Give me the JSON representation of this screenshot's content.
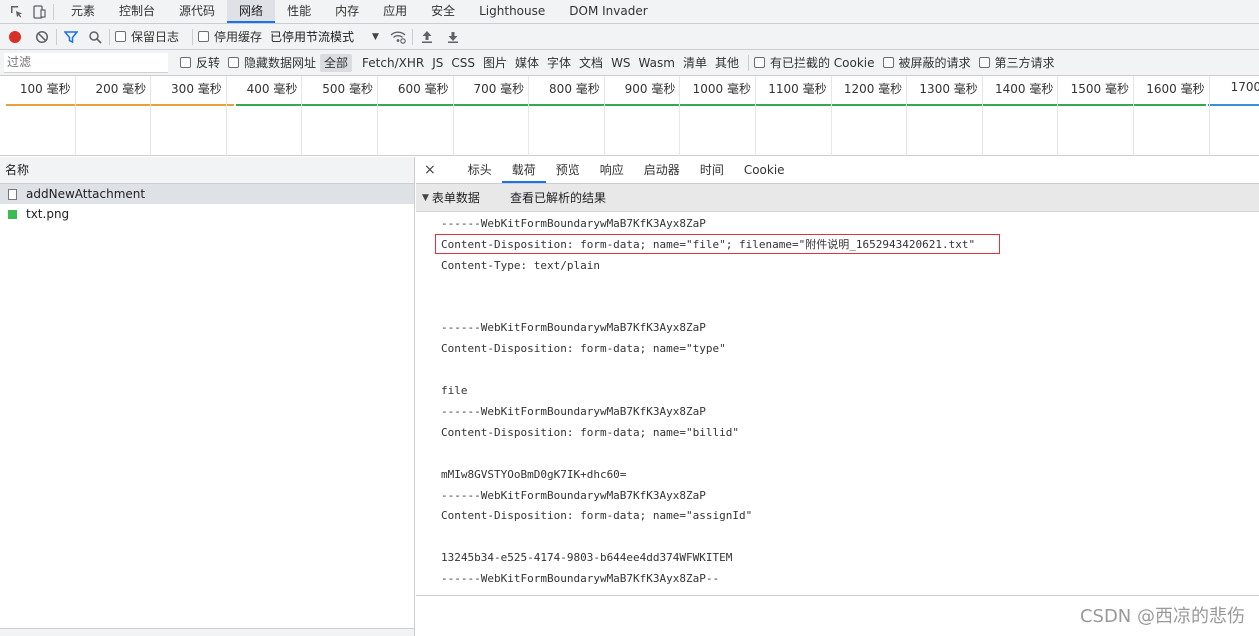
{
  "tabs": [
    "元素",
    "控制台",
    "源代码",
    "网络",
    "性能",
    "内存",
    "应用",
    "安全",
    "Lighthouse",
    "DOM Invader"
  ],
  "active_tab": "网络",
  "toolbar": {
    "preserve_log": "保留日志",
    "disable_cache": "停用缓存",
    "throttling": "已停用节流模式"
  },
  "filter": {
    "placeholder": "过滤",
    "invert": "反转",
    "hide_data_urls": "隐藏数据网址",
    "types": [
      "全部",
      "Fetch/XHR",
      "JS",
      "CSS",
      "图片",
      "媒体",
      "字体",
      "文档",
      "WS",
      "Wasm",
      "清单",
      "其他"
    ],
    "blocked_cookies": "有已拦截的 Cookie",
    "blocked_requests": "被屏蔽的请求",
    "third_party": "第三方请求"
  },
  "timeline": {
    "ticks": [
      "100 毫秒",
      "200 毫秒",
      "300 毫秒",
      "400 毫秒",
      "500 毫秒",
      "600 毫秒",
      "700 毫秒",
      "800 毫秒",
      "900 毫秒",
      "1000 毫秒",
      "1100 毫秒",
      "1200 毫秒",
      "1300 毫秒",
      "1400 毫秒",
      "1500 毫秒",
      "1600 毫秒",
      "1700"
    ]
  },
  "requests": {
    "header": "名称",
    "items": [
      "addNewAttachment",
      "txt.png"
    ]
  },
  "detail": {
    "close": "×",
    "tabs": [
      "标头",
      "载荷",
      "预览",
      "响应",
      "启动器",
      "时间",
      "Cookie"
    ],
    "active": "载荷",
    "section_title": "表单数据",
    "view_parsed": "查看已解析的结果",
    "payload_lines": [
      "------WebKitFormBoundarywMaB7KfK3Ayx8ZaP",
      "Content-Disposition: form-data; name=\"file\"; filename=\"附件说明_1652943420621.txt\"",
      "Content-Type: text/plain",
      "",
      "",
      "------WebKitFormBoundarywMaB7KfK3Ayx8ZaP",
      "Content-Disposition: form-data; name=\"type\"",
      "",
      "file",
      "------WebKitFormBoundarywMaB7KfK3Ayx8ZaP",
      "Content-Disposition: form-data; name=\"billid\"",
      "",
      "mMIw8GVSTYOoBmD0gK7IK+dhc60=",
      "------WebKitFormBoundarywMaB7KfK3Ayx8ZaP",
      "Content-Disposition: form-data; name=\"assignId\"",
      "",
      "13245b34-e525-4174-9803-b644ee4dd374WFWKITEM",
      "------WebKitFormBoundarywMaB7KfK3Ayx8ZaP--"
    ]
  },
  "watermark": "CSDN @西凉的悲伤",
  "colors": {
    "accent": "#1a73e8",
    "record": "#d93025",
    "highlight": "#d9363e"
  }
}
